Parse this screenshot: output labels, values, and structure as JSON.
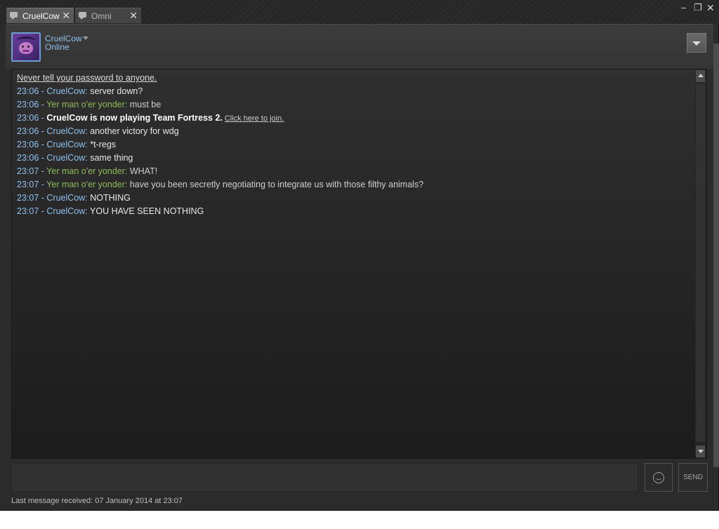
{
  "tabs": [
    {
      "label": "CruelCow",
      "active": true,
      "icon": "chat-bubble-icon"
    },
    {
      "label": "Omni",
      "active": false,
      "icon": "chat-bubble-icon"
    }
  ],
  "window_controls": {
    "minimize": "–",
    "maximize": "❐",
    "close": "✕"
  },
  "header": {
    "username": "CruelCow",
    "status": "Online",
    "avatar": "purple-cow-avatar-icon"
  },
  "chat": {
    "warning": "Never tell your password to anyone.",
    "messages": [
      {
        "time": "23:06 - ",
        "sender": "CruelCow",
        "sep": ": ",
        "text": "server down?"
      },
      {
        "time": "23:06 - ",
        "sender": "Yer man o'er yonder",
        "sep": ": ",
        "text": "must be"
      },
      {
        "time": "23:06 - ",
        "notify": "CruelCow is now playing Team Fortress 2.",
        "link": "Click here to join."
      },
      {
        "time": "23:06 - ",
        "sender": "CruelCow",
        "sep": ": ",
        "text": "another victory for wdg"
      },
      {
        "time": "23:06 - ",
        "sender": "CruelCow",
        "sep": ": ",
        "text": "*t-regs"
      },
      {
        "time": "23:06 - ",
        "sender": "CruelCow",
        "sep": ": ",
        "text": "same thing"
      },
      {
        "time": "23:07 - ",
        "sender": "Yer man o'er yonder",
        "sep": ": ",
        "text": "WHAT!"
      },
      {
        "time": "23:07 - ",
        "sender": "Yer man o'er yonder",
        "sep": ": ",
        "text": "have you been secretly negotiating to integrate us with those filthy animals?"
      },
      {
        "time": "23:07 - ",
        "sender": "CruelCow",
        "sep": ": ",
        "text": "NOTHING"
      },
      {
        "time": "23:07 - ",
        "sender": "CruelCow",
        "sep": ": ",
        "text": "YOU HAVE SEEN NOTHING"
      }
    ]
  },
  "input": {
    "value": "",
    "send_label": "SEND",
    "emoticon_icon": "smiley-icon"
  },
  "footer": {
    "last_message": "Last message received: 07 January 2014 at 23:07"
  },
  "colors": {
    "self": "#8fc1ea",
    "friend": "#8fbc55",
    "timestamp": "#8fc1ea",
    "background": "#2b2b2b"
  }
}
